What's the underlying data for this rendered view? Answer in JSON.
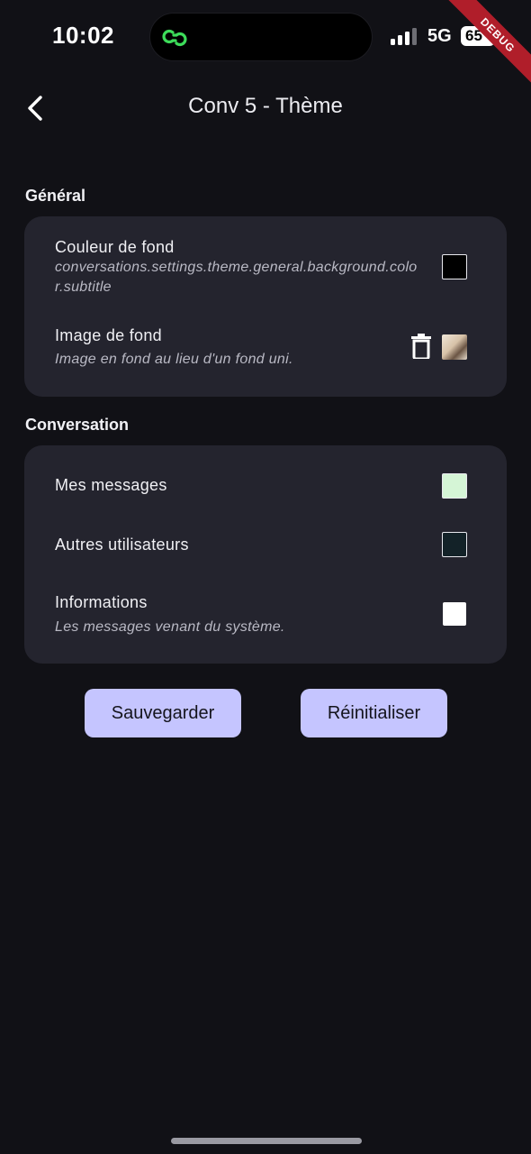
{
  "status_bar": {
    "time": "10:02",
    "network": "5G",
    "battery": "65",
    "debug_banner": "DEBUG"
  },
  "header": {
    "title": "Conv 5 - Thème"
  },
  "sections": {
    "general": {
      "title": "Général",
      "background_color": {
        "label": "Couleur de fond",
        "subtitle": "conversations.settings.theme.general.background.color.subtitle",
        "color": "#000000"
      },
      "background_image": {
        "label": "Image de fond",
        "subtitle": "Image en fond au lieu d'un fond uni."
      }
    },
    "conversation": {
      "title": "Conversation",
      "my_messages": {
        "label": "Mes messages",
        "color": "#d5f5d6"
      },
      "other_users": {
        "label": "Autres utilisateurs",
        "color": "#132228"
      },
      "information": {
        "label": "Informations",
        "subtitle": "Les messages venant du système.",
        "color": "#ffffff"
      }
    }
  },
  "actions": {
    "save_label": "Sauvegarder",
    "reset_label": "Réinitialiser",
    "button_color": "#c5c5ff"
  },
  "colors": {
    "background": "#111116",
    "card": "#24242e",
    "island_icon": "#3ddc5a",
    "debug_ribbon": "#b01e2a"
  },
  "icons": [
    "link-icon",
    "signal-icon",
    "back-arrow-icon",
    "trash-icon"
  ]
}
